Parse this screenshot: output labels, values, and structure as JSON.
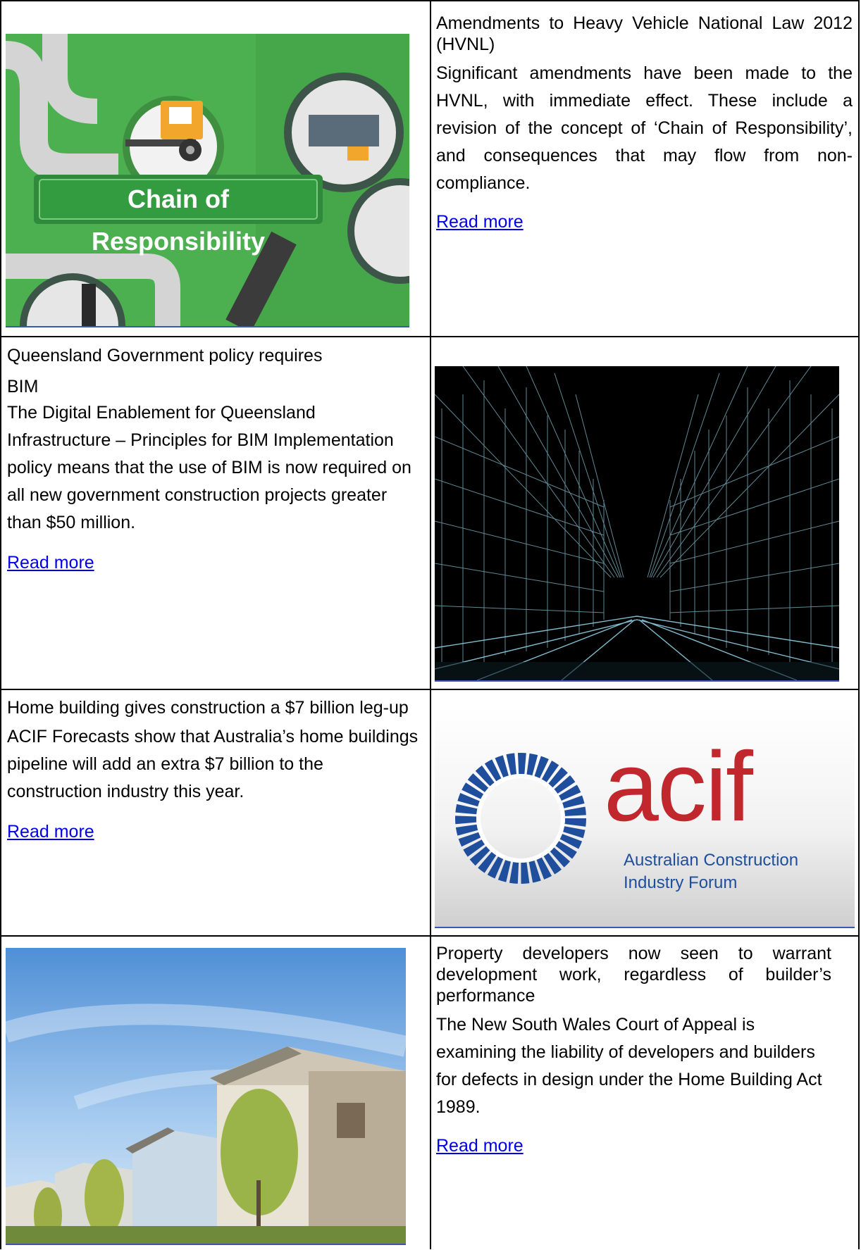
{
  "articles": [
    {
      "headline": "Amendments to Heavy Vehicle National Law 2012 (HVNL)",
      "body": "Significant amendments have been made to the HVNL, with immediate effect. These include a revision of the concept of ‘Chain of Responsibility’, and consequences that may flow from non-compliance.",
      "link_label": "Read more",
      "image_caption": "Chain of Responsibility"
    },
    {
      "headline": "Queensland Government policy requires",
      "subheadline": "BIM",
      "body": "The Digital Enablement for Queensland Infrastructure – Principles for BIM Implementation policy means that the use of BIM is now required on all new government construction projects greater than $50 million.",
      "link_label": "Read more"
    },
    {
      "headline": "Home building gives construction a $7 billion leg-up",
      "body": "ACIF Forecasts show that Australia’s home buildings pipeline will add an extra $7 billion to the construction industry this year.",
      "link_label": "Read more",
      "logo_word": "acif",
      "logo_line1": "Australian Construction",
      "logo_line2": "Industry Forum"
    },
    {
      "headline": "Property developers now seen to warrant development work, regardless of builder’s performance",
      "body": "The New South Wales Court of Appeal is examining the liability of developers and builders for defects in design under the Home Building Act 1989.",
      "link_label": "Read more"
    }
  ]
}
